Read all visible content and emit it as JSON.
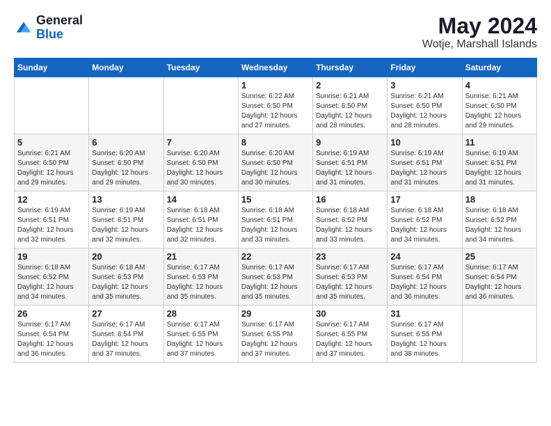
{
  "header": {
    "logo_general": "General",
    "logo_blue": "Blue",
    "month_year": "May 2024",
    "location": "Wotje, Marshall Islands"
  },
  "weekdays": [
    "Sunday",
    "Monday",
    "Tuesday",
    "Wednesday",
    "Thursday",
    "Friday",
    "Saturday"
  ],
  "weeks": [
    [
      {
        "day": "",
        "info": ""
      },
      {
        "day": "",
        "info": ""
      },
      {
        "day": "",
        "info": ""
      },
      {
        "day": "1",
        "info": "Sunrise: 6:22 AM\nSunset: 6:50 PM\nDaylight: 12 hours\nand 27 minutes."
      },
      {
        "day": "2",
        "info": "Sunrise: 6:21 AM\nSunset: 6:50 PM\nDaylight: 12 hours\nand 28 minutes."
      },
      {
        "day": "3",
        "info": "Sunrise: 6:21 AM\nSunset: 6:50 PM\nDaylight: 12 hours\nand 28 minutes."
      },
      {
        "day": "4",
        "info": "Sunrise: 6:21 AM\nSunset: 6:50 PM\nDaylight: 12 hours\nand 29 minutes."
      }
    ],
    [
      {
        "day": "5",
        "info": "Sunrise: 6:21 AM\nSunset: 6:50 PM\nDaylight: 12 hours\nand 29 minutes."
      },
      {
        "day": "6",
        "info": "Sunrise: 6:20 AM\nSunset: 6:50 PM\nDaylight: 12 hours\nand 29 minutes."
      },
      {
        "day": "7",
        "info": "Sunrise: 6:20 AM\nSunset: 6:50 PM\nDaylight: 12 hours\nand 30 minutes."
      },
      {
        "day": "8",
        "info": "Sunrise: 6:20 AM\nSunset: 6:50 PM\nDaylight: 12 hours\nand 30 minutes."
      },
      {
        "day": "9",
        "info": "Sunrise: 6:19 AM\nSunset: 6:51 PM\nDaylight: 12 hours\nand 31 minutes."
      },
      {
        "day": "10",
        "info": "Sunrise: 6:19 AM\nSunset: 6:51 PM\nDaylight: 12 hours\nand 31 minutes."
      },
      {
        "day": "11",
        "info": "Sunrise: 6:19 AM\nSunset: 6:51 PM\nDaylight: 12 hours\nand 31 minutes."
      }
    ],
    [
      {
        "day": "12",
        "info": "Sunrise: 6:19 AM\nSunset: 6:51 PM\nDaylight: 12 hours\nand 32 minutes."
      },
      {
        "day": "13",
        "info": "Sunrise: 6:19 AM\nSunset: 6:51 PM\nDaylight: 12 hours\nand 32 minutes."
      },
      {
        "day": "14",
        "info": "Sunrise: 6:18 AM\nSunset: 6:51 PM\nDaylight: 12 hours\nand 32 minutes."
      },
      {
        "day": "15",
        "info": "Sunrise: 6:18 AM\nSunset: 6:51 PM\nDaylight: 12 hours\nand 33 minutes."
      },
      {
        "day": "16",
        "info": "Sunrise: 6:18 AM\nSunset: 6:52 PM\nDaylight: 12 hours\nand 33 minutes."
      },
      {
        "day": "17",
        "info": "Sunrise: 6:18 AM\nSunset: 6:52 PM\nDaylight: 12 hours\nand 34 minutes."
      },
      {
        "day": "18",
        "info": "Sunrise: 6:18 AM\nSunset: 6:52 PM\nDaylight: 12 hours\nand 34 minutes."
      }
    ],
    [
      {
        "day": "19",
        "info": "Sunrise: 6:18 AM\nSunset: 6:52 PM\nDaylight: 12 hours\nand 34 minutes."
      },
      {
        "day": "20",
        "info": "Sunrise: 6:18 AM\nSunset: 6:53 PM\nDaylight: 12 hours\nand 35 minutes."
      },
      {
        "day": "21",
        "info": "Sunrise: 6:17 AM\nSunset: 6:53 PM\nDaylight: 12 hours\nand 35 minutes."
      },
      {
        "day": "22",
        "info": "Sunrise: 6:17 AM\nSunset: 6:53 PM\nDaylight: 12 hours\nand 35 minutes."
      },
      {
        "day": "23",
        "info": "Sunrise: 6:17 AM\nSunset: 6:53 PM\nDaylight: 12 hours\nand 35 minutes."
      },
      {
        "day": "24",
        "info": "Sunrise: 6:17 AM\nSunset: 6:54 PM\nDaylight: 12 hours\nand 36 minutes."
      },
      {
        "day": "25",
        "info": "Sunrise: 6:17 AM\nSunset: 6:54 PM\nDaylight: 12 hours\nand 36 minutes."
      }
    ],
    [
      {
        "day": "26",
        "info": "Sunrise: 6:17 AM\nSunset: 6:54 PM\nDaylight: 12 hours\nand 36 minutes."
      },
      {
        "day": "27",
        "info": "Sunrise: 6:17 AM\nSunset: 6:54 PM\nDaylight: 12 hours\nand 37 minutes."
      },
      {
        "day": "28",
        "info": "Sunrise: 6:17 AM\nSunset: 6:55 PM\nDaylight: 12 hours\nand 37 minutes."
      },
      {
        "day": "29",
        "info": "Sunrise: 6:17 AM\nSunset: 6:55 PM\nDaylight: 12 hours\nand 37 minutes."
      },
      {
        "day": "30",
        "info": "Sunrise: 6:17 AM\nSunset: 6:55 PM\nDaylight: 12 hours\nand 37 minutes."
      },
      {
        "day": "31",
        "info": "Sunrise: 6:17 AM\nSunset: 6:55 PM\nDaylight: 12 hours\nand 38 minutes."
      },
      {
        "day": "",
        "info": ""
      }
    ]
  ]
}
